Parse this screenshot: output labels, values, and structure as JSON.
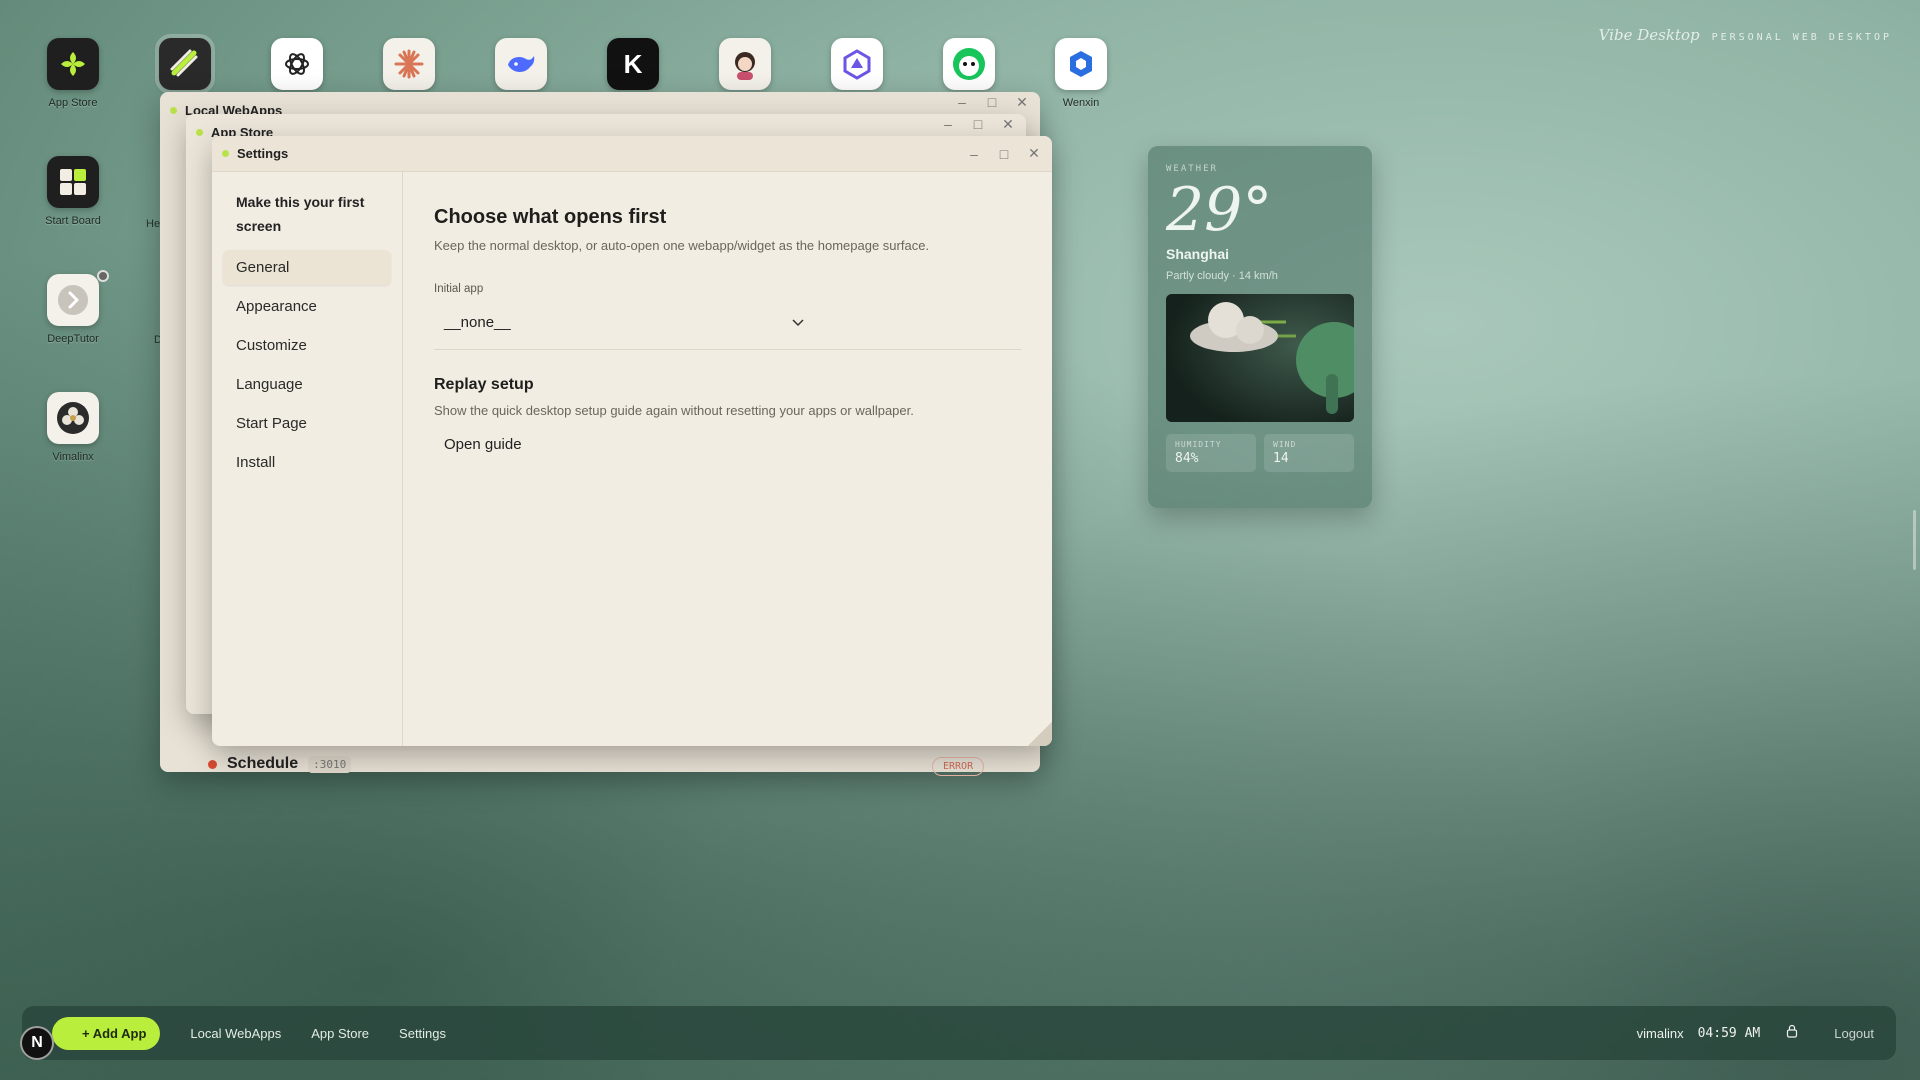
{
  "brand": {
    "name": "Vibe Desktop",
    "tagline": "PERSONAL WEB DESKTOP"
  },
  "desktop_icons": [
    {
      "label": "App Store",
      "icon": "app-store-icon"
    },
    {
      "label": "Start Board",
      "icon": "start-board-icon"
    },
    {
      "label": "DeepTutor",
      "icon": "deeptutor-icon"
    },
    {
      "label": "Vimalinx",
      "icon": "vimalinx-icon"
    },
    {
      "label": "Wenxin",
      "icon": "wenxin-icon"
    }
  ],
  "partial_labels": {
    "he": "He",
    "d": "D"
  },
  "windows": {
    "local": {
      "title": "Local WebApps"
    },
    "appstore": {
      "title": "App Store"
    },
    "schedule": {
      "name": "Schedule",
      "port": ":3010",
      "status": "ERROR"
    }
  },
  "settings": {
    "title": "Settings",
    "sidebar_heading": "Make this your first screen",
    "nav": [
      "General",
      "Appearance",
      "Customize",
      "Language",
      "Start Page",
      "Install"
    ],
    "active_nav": "General",
    "heading": "Choose what opens first",
    "description": "Keep the normal desktop, or auto-open one webapp/widget as the homepage surface.",
    "initial_app_label": "Initial app",
    "initial_app_value": "__none__",
    "replay_heading": "Replay setup",
    "replay_description": "Show the quick desktop setup guide again without resetting your apps or wallpaper.",
    "open_guide_label": "Open guide"
  },
  "weather": {
    "label": "WEATHER",
    "temp": "29°",
    "city": "Shanghai",
    "condition": "Partly cloudy · 14 km/h",
    "humidity_label": "HUMIDITY",
    "humidity": "84%",
    "wind_label": "WIND",
    "wind": "14"
  },
  "taskbar": {
    "add_app": "+ Add App",
    "tasks": [
      "Local WebApps",
      "App Store",
      "Settings"
    ],
    "user": "vimalinx",
    "time": "04:59 AM",
    "logout": "Logout",
    "badge": "N"
  },
  "colors": {
    "accent": "#b9ee3c",
    "error": "#d94a2f"
  }
}
